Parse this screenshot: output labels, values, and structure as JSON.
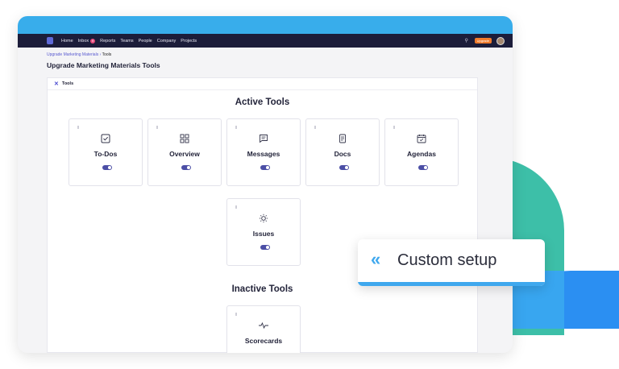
{
  "nav": {
    "items": [
      "Home",
      "Inbox",
      "Reports",
      "Teams",
      "People",
      "Company",
      "Projects"
    ],
    "inbox_badge": "9",
    "trial_label": "Upgrade"
  },
  "breadcrumb": {
    "parent": "Upgrade Marketing Materials",
    "separator": " › ",
    "current": "Tools"
  },
  "page_title": "Upgrade Marketing Materials Tools",
  "panel": {
    "title": "Tools"
  },
  "active_section": {
    "title": "Active Tools",
    "tools": [
      {
        "label": "To-Dos",
        "icon": "checkbox-icon"
      },
      {
        "label": "Overview",
        "icon": "grid-icon"
      },
      {
        "label": "Messages",
        "icon": "message-icon"
      },
      {
        "label": "Docs",
        "icon": "document-icon"
      },
      {
        "label": "Agendas",
        "icon": "calendar-icon"
      },
      {
        "label": "Issues",
        "icon": "sun-icon"
      }
    ]
  },
  "inactive_section": {
    "title": "Inactive Tools",
    "tools": [
      {
        "label": "Scorecards",
        "icon": "pulse-icon"
      }
    ]
  },
  "callout": {
    "text": "Custom setup",
    "icon": "double-chevron-left-icon"
  },
  "colors": {
    "accent": "#38adeb",
    "toggle": "#4c4fa6",
    "nav": "#1c1d3a",
    "teal": "#3dbfa8",
    "blue": "#2b8ff2"
  }
}
